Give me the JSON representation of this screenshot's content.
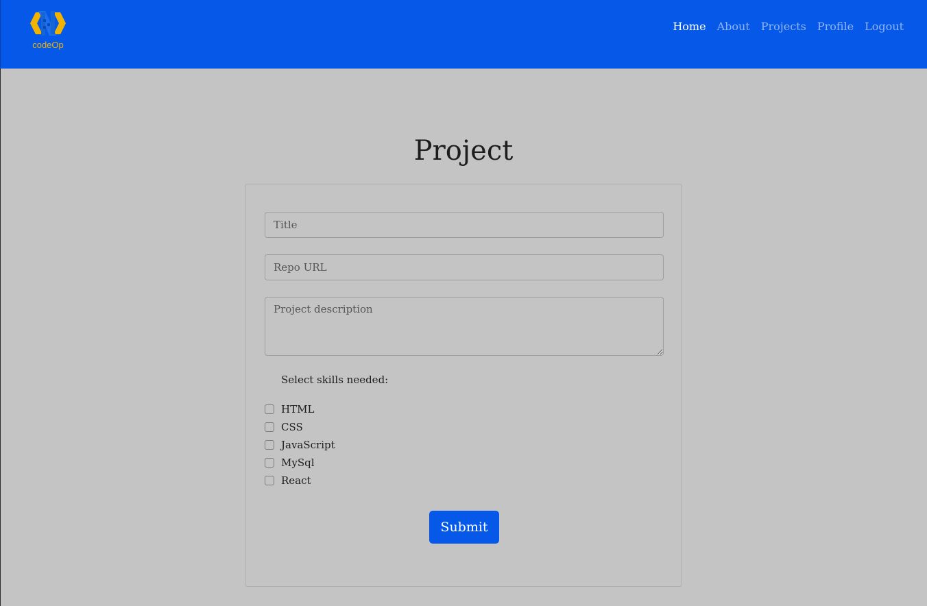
{
  "brand": {
    "name": "codeOp",
    "icon": "codeop-logo-icon",
    "colors": {
      "gold": "#f0b400",
      "blue": "#1e6fe8"
    }
  },
  "nav": {
    "items": [
      {
        "label": "Home",
        "active": true
      },
      {
        "label": "About",
        "active": false
      },
      {
        "label": "Projects",
        "active": false
      },
      {
        "label": "Profile",
        "active": false
      },
      {
        "label": "Logout",
        "active": false
      }
    ]
  },
  "page": {
    "title": "Project"
  },
  "form": {
    "title_placeholder": "Title",
    "repo_placeholder": "Repo URL",
    "description_placeholder": "Project description",
    "skills_label": "Select skills needed:",
    "skills": [
      {
        "label": "HTML",
        "checked": false
      },
      {
        "label": "CSS",
        "checked": false
      },
      {
        "label": "JavaScript",
        "checked": false
      },
      {
        "label": "MySql",
        "checked": false
      },
      {
        "label": "React",
        "checked": false
      }
    ],
    "submit_label": "Submit"
  },
  "colors": {
    "navbar": "#0659e8",
    "background": "#c4c4c4",
    "primary_button": "#0659e8"
  }
}
